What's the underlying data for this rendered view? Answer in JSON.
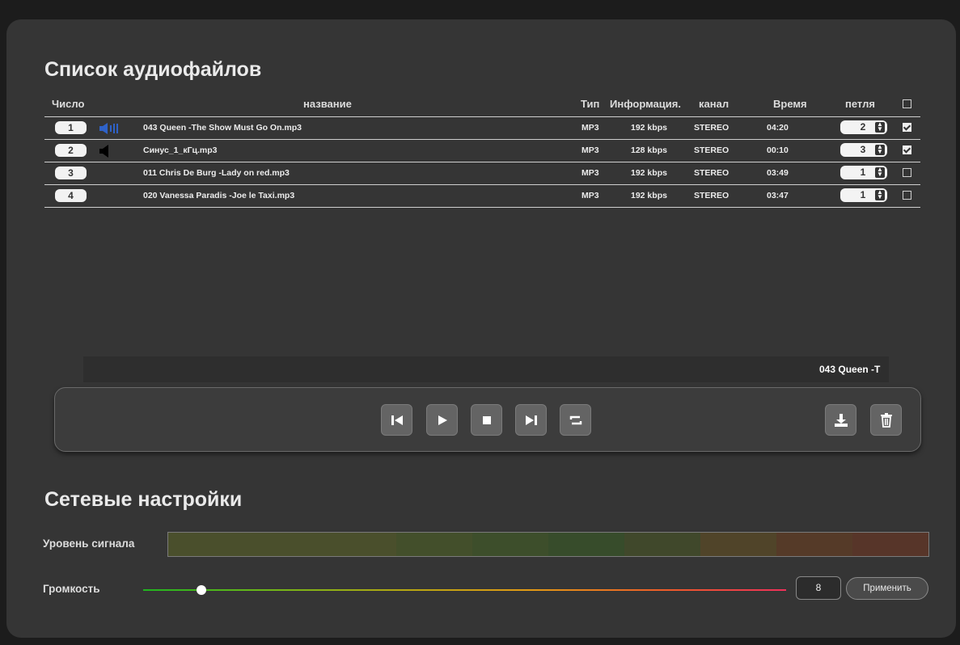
{
  "audio_section": {
    "title": "Список аудиофайлов",
    "columns": {
      "number": "Число",
      "name": "название",
      "type": "Тип",
      "info": "Информация.",
      "channel": "канал",
      "time": "Время",
      "loop": "петля"
    },
    "header_checkbox_checked": false,
    "files": [
      {
        "number": "1",
        "speaker": "playing",
        "name": "043 Queen -The Show Must Go On.mp3",
        "type": "MP3",
        "bitrate": "192 kbps",
        "channel": "STEREO",
        "time": "04:20",
        "loop": "2",
        "checked": true
      },
      {
        "number": "2",
        "speaker": "muted",
        "name": "Синус_1_кГц.mp3",
        "type": "MP3",
        "bitrate": "128 kbps",
        "channel": "STEREO",
        "time": "00:10",
        "loop": "3",
        "checked": true
      },
      {
        "number": "3",
        "speaker": "none",
        "name": "011 Chris De Burg -Lady on red.mp3",
        "type": "MP3",
        "bitrate": "192 kbps",
        "channel": "STEREO",
        "time": "03:49",
        "loop": "1",
        "checked": false
      },
      {
        "number": "4",
        "speaker": "none",
        "name": "020 Vanessa Paradis -Joe le Taxi.mp3",
        "type": "MP3",
        "bitrate": "192 kbps",
        "channel": "STEREO",
        "time": "03:47",
        "loop": "1",
        "checked": false
      }
    ],
    "now_playing": "043 Queen -T"
  },
  "player_controls": {
    "buttons": [
      "skip-previous-icon",
      "play-icon",
      "stop-icon",
      "skip-next-icon",
      "repeat-icon"
    ],
    "right_buttons": [
      "download-icon",
      "trash-icon"
    ]
  },
  "network_section": {
    "title": "Сетевые настройки",
    "signal_label": "Уровень сигнала",
    "signal_colors": [
      "#4a4f2c",
      "#4a4f2c",
      "#4a4f2c",
      "#434f2b",
      "#3d4e2b",
      "#374c2b",
      "#40482b",
      "#504429",
      "#553a28",
      "#573529"
    ],
    "volume_label": "Громкость",
    "volume_value": "8",
    "volume_fraction": 0.09,
    "apply_label": "Применить"
  },
  "colors": {
    "accent_speaker": "#2f62c8",
    "panel": "#353535"
  }
}
